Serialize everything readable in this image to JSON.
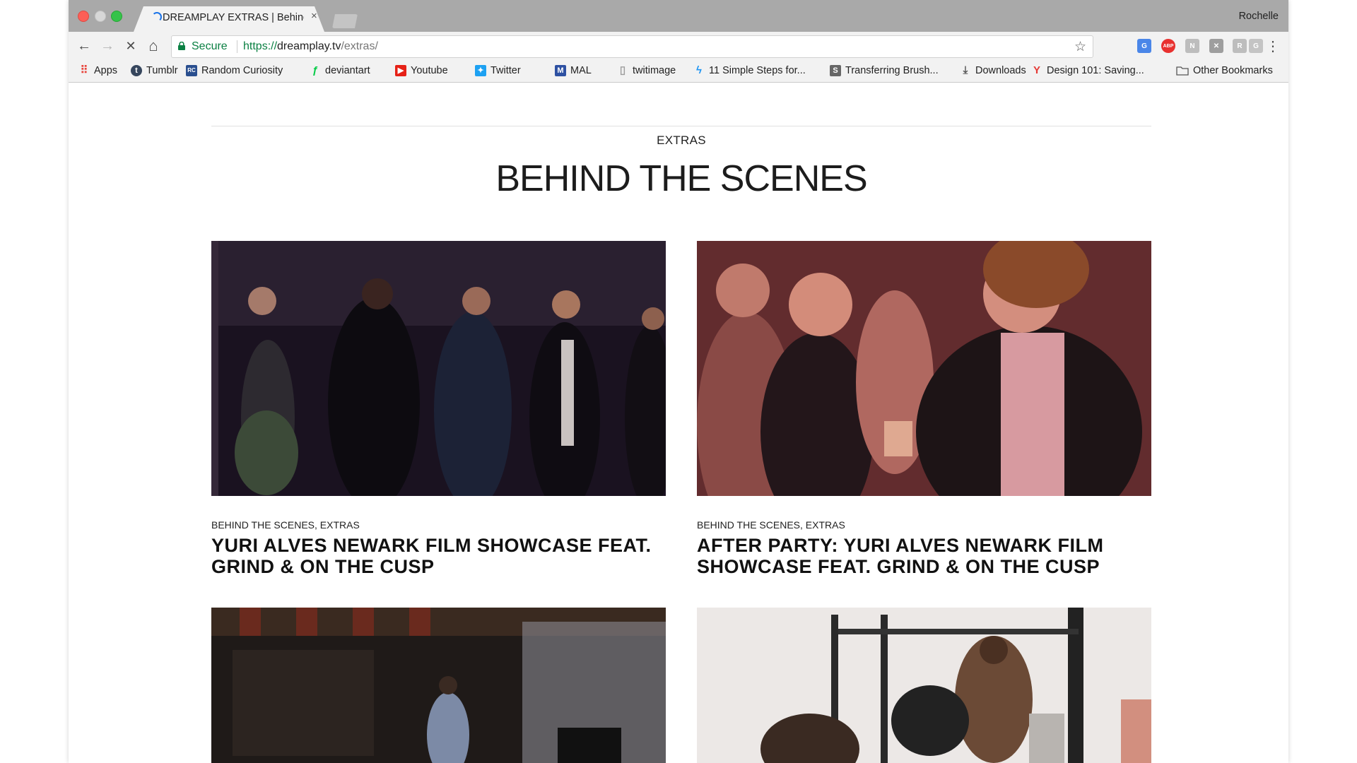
{
  "browser": {
    "tab_title": "DREAMPLAY EXTRAS | Behind",
    "tab_close": "×",
    "profile_name": "Rochelle",
    "secure_label": "Secure",
    "url_scheme": "https://",
    "url_host": "dreamplay.tv",
    "url_path": "/extras/",
    "back_glyph": "←",
    "forward_glyph": "→",
    "stop_glyph": "✕",
    "home_glyph": "⌂",
    "star_glyph": "☆",
    "menu_glyph": "⋮",
    "extensions": [
      {
        "name": "translate-extension-icon",
        "label": "G",
        "color": "#4a86e8"
      },
      {
        "name": "adblock-extension-icon",
        "label": "ABP",
        "color": "#e8312f"
      },
      {
        "name": "extension-nr-icon",
        "label": "N",
        "color": "#bdbdbd"
      },
      {
        "name": "extension-cross-icon",
        "label": "✕",
        "color": "#9e9e9e"
      },
      {
        "name": "extension-r-icon",
        "label": "R",
        "color": "#bdbdbd"
      },
      {
        "name": "extension-g-icon",
        "label": "G",
        "color": "#c4c4c4"
      }
    ]
  },
  "bookmarks": [
    {
      "name": "bookmark-apps",
      "label": "Apps",
      "icon": "apps-grid-icon",
      "glyph": "⠿",
      "color": "#e8453c"
    },
    {
      "name": "bookmark-tumblr",
      "label": "Tumblr",
      "icon": "tumblr-icon",
      "glyph": "t",
      "color": "#36465d"
    },
    {
      "name": "bookmark-random-curiosity",
      "label": "Random Curiosity",
      "icon": "random-curiosity-icon",
      "glyph": "RC",
      "color": "#2a4f8f"
    },
    {
      "name": "bookmark-deviantart",
      "label": "deviantart",
      "icon": "deviantart-icon",
      "glyph": "ƒ",
      "color": "#05cc47"
    },
    {
      "name": "bookmark-youtube",
      "label": "Youtube",
      "icon": "youtube-icon",
      "glyph": "▶",
      "color": "#e62117"
    },
    {
      "name": "bookmark-twitter",
      "label": "Twitter",
      "icon": "twitter-icon",
      "glyph": "✦",
      "color": "#1da1f2"
    },
    {
      "name": "bookmark-mal",
      "label": "MAL",
      "icon": "mal-icon",
      "glyph": "M",
      "color": "#2e51a2"
    },
    {
      "name": "bookmark-twitimage",
      "label": "twitimage",
      "icon": "page-icon",
      "glyph": "▯",
      "color": "#9e9e9e"
    },
    {
      "name": "bookmark-11-simple-steps",
      "label": "11 Simple Steps for...",
      "icon": "lightning-icon",
      "glyph": "ϟ",
      "color": "#2196f3"
    },
    {
      "name": "bookmark-transferring-brush",
      "label": "Transferring Brush...",
      "icon": "transferring-icon",
      "glyph": "S",
      "color": "#666666"
    },
    {
      "name": "bookmark-downloads",
      "label": "Downloads",
      "icon": "download-icon",
      "glyph": "⤓",
      "color": "#555555"
    },
    {
      "name": "bookmark-design-101",
      "label": "Design 101: Saving...",
      "icon": "design-icon",
      "glyph": "Y",
      "color": "#e53935"
    }
  ],
  "other_bookmarks": "Other Bookmarks",
  "page": {
    "section": "EXTRAS",
    "title": "BEHIND THE SCENES",
    "posts": [
      {
        "categories": "BEHIND THE SCENES, EXTRAS",
        "title": "YURI ALVES NEWARK FILM SHOWCASE FEAT. GRIND & ON THE CUSP"
      },
      {
        "categories": "BEHIND THE SCENES, EXTRAS",
        "title": "AFTER PARTY: YURI ALVES NEWARK FILM SHOWCASE FEAT. GRIND & ON THE CUSP"
      },
      {
        "categories": "",
        "title": ""
      },
      {
        "categories": "",
        "title": ""
      }
    ]
  }
}
